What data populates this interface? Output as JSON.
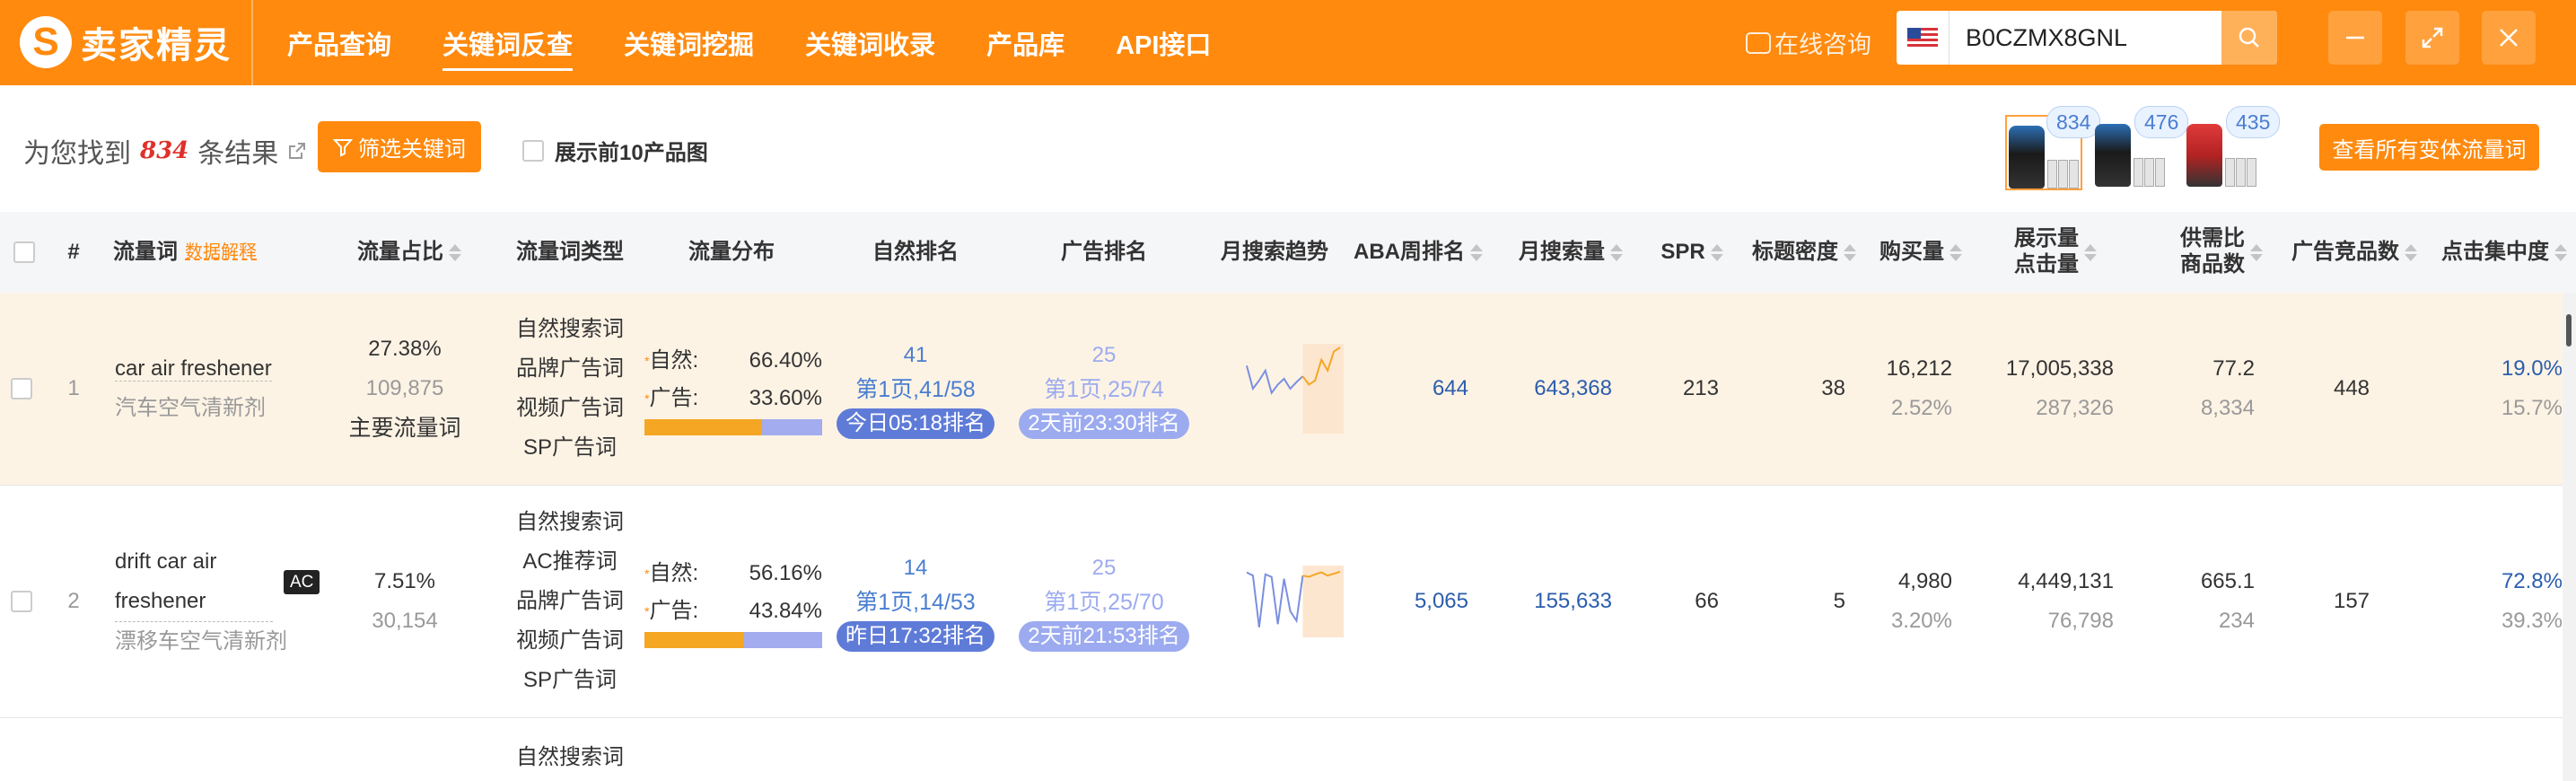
{
  "app": {
    "logo_text": "卖家精灵",
    "nav": [
      "产品查询",
      "关键词反查",
      "关键词挖掘",
      "关键词收录",
      "产品库",
      "API接口"
    ],
    "nav_active_index": 1,
    "consult": "在线咨询",
    "search_value": "B0CZMX8GNL",
    "brand_color": "#ff8a0e"
  },
  "summary": {
    "prefix": "为您找到",
    "count": "834",
    "suffix": "条结果",
    "filter_label": "筛选关键词",
    "top10_label": "展示前10产品图",
    "variant_badges": [
      "834",
      "476",
      "435"
    ],
    "view_all_label": "查看所有变体流量词"
  },
  "table": {
    "headers": {
      "index": "#",
      "keyword": "流量词",
      "keyword_explain": "数据解释",
      "share": "流量占比",
      "type": "流量词类型",
      "dist": "流量分布",
      "organic_rank": "自然排名",
      "ad_rank": "广告排名",
      "trend": "月搜索趋势",
      "aba": "ABA周排名",
      "monthly": "月搜索量",
      "spr": "SPR",
      "title_density": "标题密度",
      "purchase": "购买量",
      "impressions_1": "展示量",
      "impressions_2": "点击量",
      "supply_1": "供需比",
      "supply_2": "商品数",
      "ad_competitors": "广告竞品数",
      "click_conc": "点击集中度"
    },
    "rows": [
      {
        "index": "1",
        "keyword": "car air freshener",
        "keyword_cn": "汽车空气清新剂",
        "ac": "",
        "share_pct": "27.38%",
        "share_num": "109,875",
        "share_tag": "主要流量词",
        "types": [
          "自然搜索词",
          "品牌广告词",
          "视频广告词",
          "SP广告词"
        ],
        "dist_natural_label": "自然:",
        "dist_natural": "66.40%",
        "dist_ad_label": "广告:",
        "dist_ad": "33.60%",
        "dist_natural_frac": 0.664,
        "organic_rank": "41",
        "organic_page": "第1页,41/58",
        "organic_time": "今日05:18排名",
        "ad_rank": "25",
        "ad_page": "第1页,25/74",
        "ad_time": "2天前23:30排名",
        "trend": [
          0.78,
          0.5,
          0.6,
          0.72,
          0.45,
          0.55,
          0.62,
          0.5,
          0.58,
          0.65,
          0.55,
          0.6,
          0.85,
          0.72,
          0.95,
          1.0
        ],
        "aba": "644",
        "monthly": "643,368",
        "spr": "213",
        "title_density": "38",
        "purchase": "16,212",
        "purchase_rate": "2.52%",
        "impressions": "17,005,338",
        "clicks": "287,326",
        "supply_ratio": "77.2",
        "products": "8,334",
        "ad_competitors": "448",
        "click_conc": "19.0%",
        "click_conc_2": "15.7%"
      },
      {
        "index": "2",
        "keyword": "drift car air freshener",
        "keyword_cn": "漂移车空气清新剂",
        "ac": "AC",
        "share_pct": "7.51%",
        "share_num": "30,154",
        "share_tag": "",
        "types": [
          "自然搜索词",
          "AC推荐词",
          "品牌广告词",
          "视频广告词",
          "SP广告词"
        ],
        "dist_natural_label": "自然:",
        "dist_natural": "56.16%",
        "dist_ad_label": "广告:",
        "dist_ad": "43.84%",
        "dist_natural_frac": 0.5616,
        "organic_rank": "14",
        "organic_page": "第1页,14/53",
        "organic_time": "昨日17:32排名",
        "ad_rank": "25",
        "ad_page": "第1页,25/70",
        "ad_time": "2天前21:53排名",
        "trend": [
          0.95,
          0.9,
          0.1,
          0.92,
          0.88,
          0.15,
          0.85,
          0.35,
          0.2,
          0.9,
          0.88,
          0.92,
          0.95,
          0.9,
          0.93,
          0.96
        ],
        "aba": "5,065",
        "monthly": "155,633",
        "spr": "66",
        "title_density": "5",
        "purchase": "4,980",
        "purchase_rate": "3.20%",
        "impressions": "4,449,131",
        "clicks": "76,798",
        "supply_ratio": "665.1",
        "products": "234",
        "ad_competitors": "157",
        "click_conc": "72.8%",
        "click_conc_2": "39.3%"
      }
    ],
    "partial_row": {
      "type_first": "自然搜索词"
    }
  }
}
